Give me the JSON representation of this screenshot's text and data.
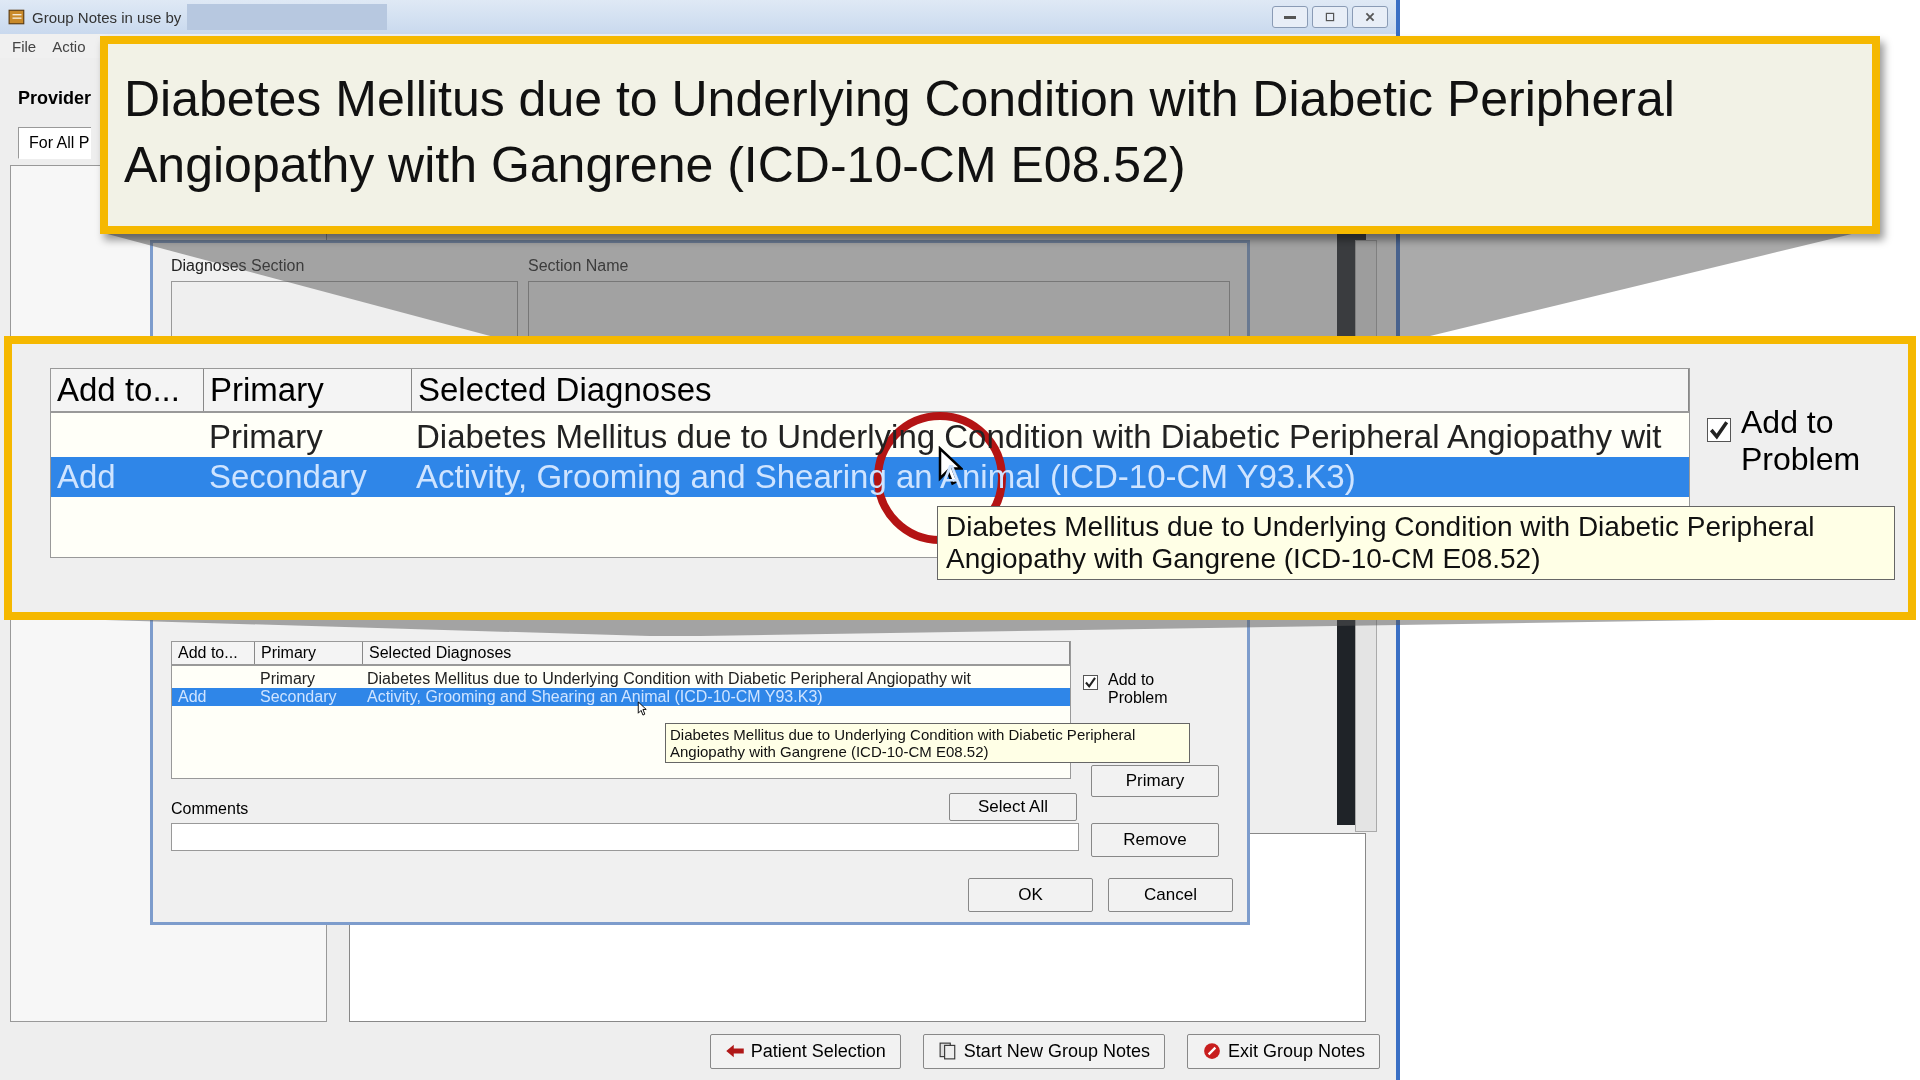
{
  "window": {
    "title": "Group Notes in use by",
    "menu": [
      "File",
      "Actio"
    ]
  },
  "provider_label": "Provider",
  "tabs": [
    {
      "label": "For All P",
      "selected": true
    }
  ],
  "dialog": {
    "section_headers": [
      "Diagnoses Section",
      "Section Name"
    ],
    "columns": [
      "Add to...",
      "Primary",
      "Selected Diagnoses"
    ],
    "rows": [
      {
        "add_to": "",
        "primary": "Primary",
        "diagnosis": "Diabetes Mellitus due to Underlying Condition with Diabetic Peripheral Angiopathy wit",
        "selected": false
      },
      {
        "add_to": "Add",
        "primary": "Secondary",
        "diagnosis": "Activity, Grooming and Shearing an Animal (ICD-10-CM Y93.K3)",
        "selected": true
      }
    ],
    "add_to_problem": {
      "label": "Add to Problem",
      "checked": true
    },
    "primary_button": "Primary",
    "comments_label": "Comments",
    "select_all": "Select All",
    "remove": "Remove",
    "ok": "OK",
    "cancel": "Cancel",
    "tooltip": "Diabetes Mellitus due to Underlying Condition with Diabetic Peripheral Angiopathy with Gangrene (ICD-10-CM E08.52)"
  },
  "bottom_buttons": [
    {
      "label": "Patient Selection",
      "kind": "back"
    },
    {
      "label": "Start New Group Notes",
      "kind": "new"
    },
    {
      "label": "Exit Group Notes",
      "kind": "exit"
    }
  ],
  "callout_top": {
    "text": "Diabetes Mellitus due to Underlying Condition with Diabetic Peripheral Angiopathy with Gangrene (ICD-10-CM E08.52)"
  },
  "callout_table": {
    "columns": [
      "Add to...",
      "Primary",
      "Selected Diagnoses"
    ],
    "rows": [
      {
        "add_to": "",
        "primary": "Primary",
        "diagnosis": "Diabetes Mellitus due to Underlying Condition with Diabetic Peripheral Angiopathy wit",
        "selected": false
      },
      {
        "add_to": "Add",
        "primary": "Secondary",
        "diagnosis": "Activity, Grooming and Shearing an Animal (ICD-10-CM Y93.K3)",
        "selected": true
      }
    ],
    "add_to_problem": {
      "label": "Add to Problem",
      "checked": true
    },
    "tooltip": "Diabetes Mellitus due to Underlying Condition with Diabetic Peripheral Angiopathy with Gangrene (ICD-10-CM E08.52)"
  }
}
